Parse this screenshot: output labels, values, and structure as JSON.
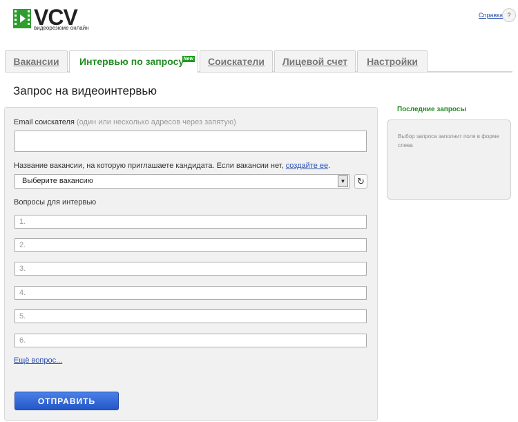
{
  "header": {
    "logo_text": "VCV",
    "logo_sub": "видеорезюме онлайн",
    "help_link": "Справка",
    "help_button": "?"
  },
  "tabs": [
    {
      "label": "Вакансии",
      "active": false
    },
    {
      "label": "Интервью по запросу",
      "active": true,
      "badge": "New"
    },
    {
      "label": "Соискатели",
      "active": false
    },
    {
      "label": "Лицевой счет",
      "active": false
    },
    {
      "label": "Настройки",
      "active": false
    }
  ],
  "page_title": "Запрос на видеоинтервью",
  "form": {
    "email_label": "Email соискателя",
    "email_hint": "(один или несколько адресов через запятую)",
    "email_value": "",
    "vacancy_label": "Название вакансии, на которую приглашаете кандидата. Если вакансии нет,",
    "vacancy_link": "создайте ее",
    "vacancy_suffix": ".",
    "vacancy_selected": "Выберите вакансию",
    "questions_label": "Вопросы для интервью",
    "questions": [
      "1.",
      "2.",
      "3.",
      "4.",
      "5.",
      "6."
    ],
    "more_link": "Ещё вопрос...",
    "submit_label": "ОТПРАВИТЬ"
  },
  "recent": {
    "title": "Последние запросы",
    "text": "Выбор запроса заполнит поля в форме слева"
  },
  "colors": {
    "accent_green": "#228b22",
    "link_blue": "#2a4fb0",
    "button_blue": "#2457c7"
  }
}
